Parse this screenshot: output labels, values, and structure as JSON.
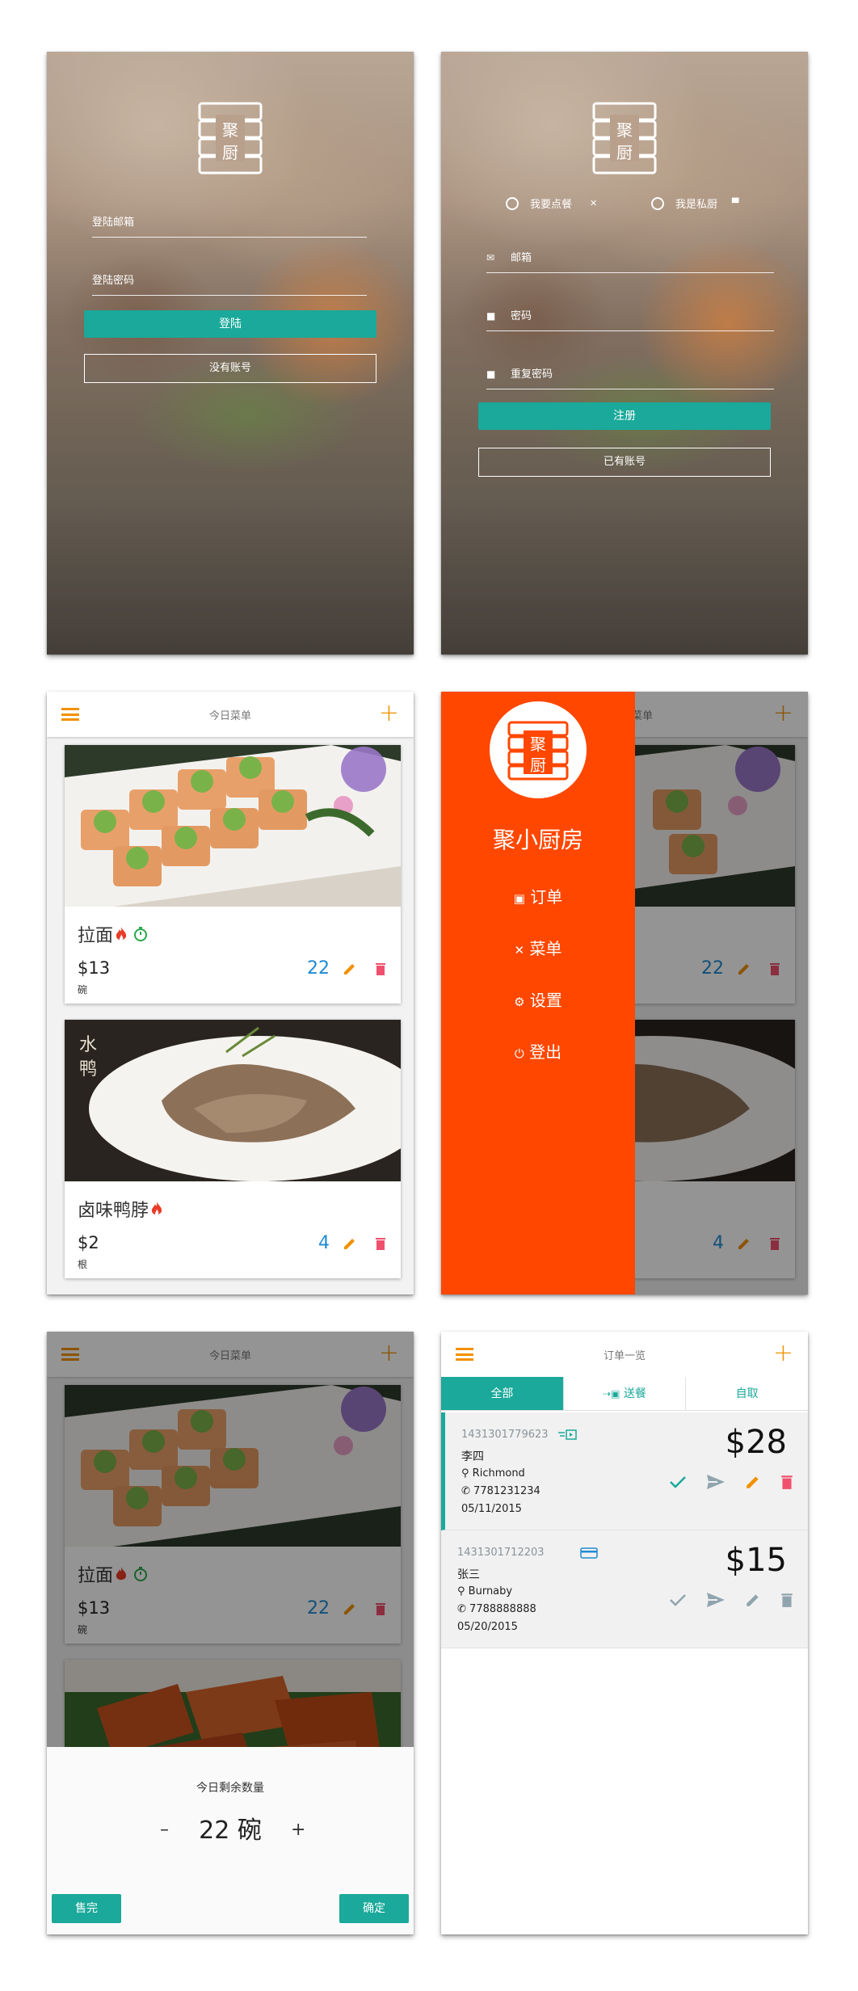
{
  "login": {
    "email_label": "登陆邮箱",
    "password_label": "登陆密码",
    "login_button": "登陆",
    "no_account_button": "没有账号"
  },
  "register": {
    "radio_customer": "我要点餐",
    "radio_chef": "我是私厨",
    "email_label": "邮箱",
    "password_label": "密码",
    "confirm_label": "重复密码",
    "register_button": "注册",
    "has_account_button": "已有账号"
  },
  "menu": {
    "title": "今日菜单",
    "dishes": [
      {
        "name": "拉面",
        "price": "$13",
        "unit": "碗",
        "qty": "22"
      },
      {
        "name": "卤味鸭脖",
        "price": "$2",
        "unit": "根",
        "qty": "4"
      }
    ]
  },
  "drawer": {
    "title": "聚小厨房",
    "items": [
      "订单",
      "菜单",
      "设置",
      "登出"
    ]
  },
  "sheet": {
    "title": "今日剩余数量",
    "minus": "–",
    "plus": "+",
    "count": "22 碗",
    "soldout_button": "售完",
    "confirm_button": "确定"
  },
  "orders": {
    "title": "订单一览",
    "tabs": [
      "全部",
      "送餐",
      "自取"
    ],
    "list": [
      {
        "id": "1431301779623",
        "name": "李四",
        "location": "Richmond",
        "phone": "7781231234",
        "date": "05/11/2015",
        "price": "$28"
      },
      {
        "id": "1431301712203",
        "name": "张三",
        "location": "Burnaby",
        "phone": "7788888888",
        "date": "05/20/2015",
        "price": "$15"
      }
    ]
  },
  "colors": {
    "teal": "#1aa99a",
    "orange": "#f29100",
    "drawer": "#ff4700",
    "blue": "#1f8ad3",
    "red": "#f0506e"
  }
}
